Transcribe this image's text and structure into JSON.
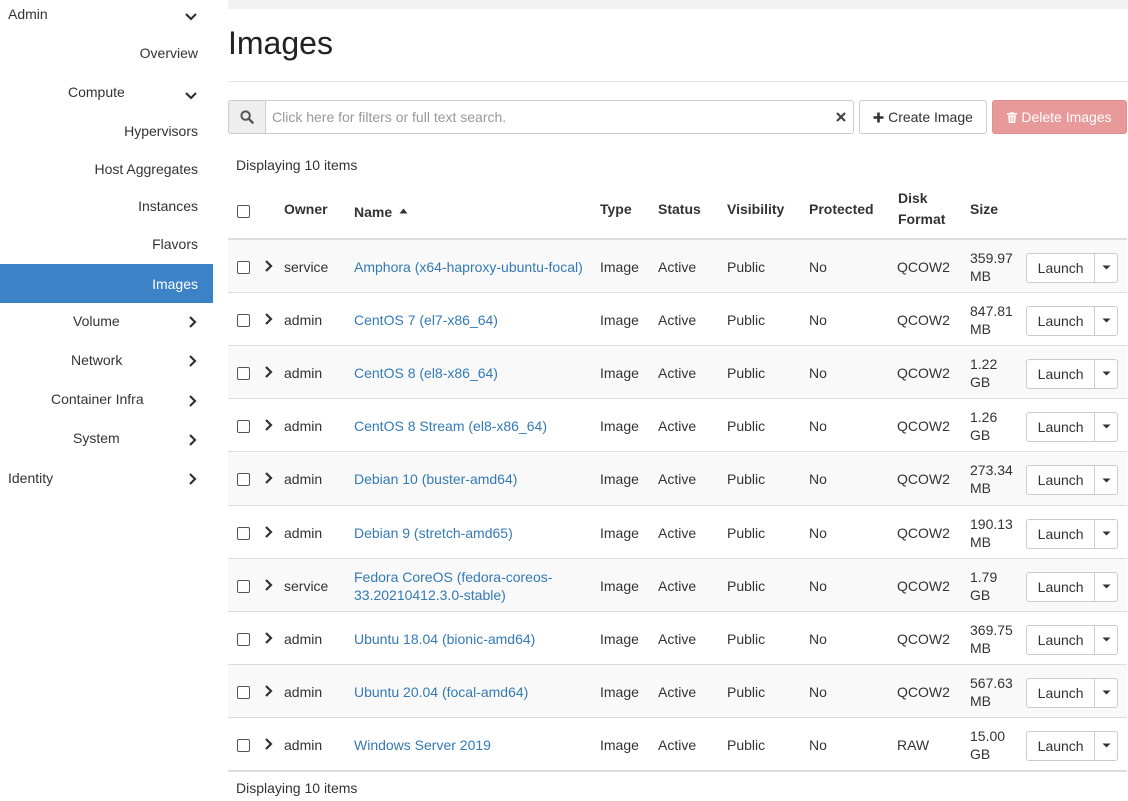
{
  "sidebar": {
    "admin": "Admin",
    "overview": "Overview",
    "compute": "Compute",
    "hypervisors": "Hypervisors",
    "host_aggregates": "Host Aggregates",
    "instances": "Instances",
    "flavors": "Flavors",
    "images": "Images",
    "volume": "Volume",
    "network": "Network",
    "container_infra": "Container Infra",
    "system": "System",
    "identity": "Identity"
  },
  "page": {
    "title": "Images"
  },
  "search": {
    "placeholder": "Click here for filters or full text search."
  },
  "toolbar": {
    "create_label": "Create Image",
    "delete_label": "Delete Images"
  },
  "table": {
    "count_top": "Displaying 10 items",
    "count_bottom": "Displaying 10 items",
    "headers": {
      "owner": "Owner",
      "name": "Name",
      "type": "Type",
      "status": "Status",
      "visibility": "Visibility",
      "protected": "Protected",
      "disk_format_1": "Disk",
      "disk_format_2": "Format",
      "size": "Size"
    },
    "launch_label": "Launch",
    "rows": [
      {
        "owner": "service",
        "name": [
          "Amphora (x64-haproxy-ubuntu-focal)"
        ],
        "type": "Image",
        "status": "Active",
        "visibility": "Public",
        "protected": "No",
        "format": "QCOW2",
        "size": [
          "359.97",
          "MB"
        ]
      },
      {
        "owner": "admin",
        "name": [
          "CentOS 7 (el7-x86_64)"
        ],
        "type": "Image",
        "status": "Active",
        "visibility": "Public",
        "protected": "No",
        "format": "QCOW2",
        "size": [
          "847.81",
          "MB"
        ]
      },
      {
        "owner": "admin",
        "name": [
          "CentOS 8 (el8-x86_64)"
        ],
        "type": "Image",
        "status": "Active",
        "visibility": "Public",
        "protected": "No",
        "format": "QCOW2",
        "size": [
          "1.22",
          "GB"
        ]
      },
      {
        "owner": "admin",
        "name": [
          "CentOS 8 Stream (el8-x86_64)"
        ],
        "type": "Image",
        "status": "Active",
        "visibility": "Public",
        "protected": "No",
        "format": "QCOW2",
        "size": [
          "1.26",
          "GB"
        ]
      },
      {
        "owner": "admin",
        "name": [
          "Debian 10 (buster-amd64)"
        ],
        "type": "Image",
        "status": "Active",
        "visibility": "Public",
        "protected": "No",
        "format": "QCOW2",
        "size": [
          "273.34",
          "MB"
        ]
      },
      {
        "owner": "admin",
        "name": [
          "Debian 9 (stretch-amd65)"
        ],
        "type": "Image",
        "status": "Active",
        "visibility": "Public",
        "protected": "No",
        "format": "QCOW2",
        "size": [
          "190.13",
          "MB"
        ]
      },
      {
        "owner": "service",
        "name": [
          "Fedora CoreOS (fedora-coreos-",
          "33.20210412.3.0-stable)"
        ],
        "type": "Image",
        "status": "Active",
        "visibility": "Public",
        "protected": "No",
        "format": "QCOW2",
        "size": [
          "1.79",
          "GB"
        ]
      },
      {
        "owner": "admin",
        "name": [
          "Ubuntu 18.04 (bionic-amd64)"
        ],
        "type": "Image",
        "status": "Active",
        "visibility": "Public",
        "protected": "No",
        "format": "QCOW2",
        "size": [
          "369.75",
          "MB"
        ]
      },
      {
        "owner": "admin",
        "name": [
          "Ubuntu 20.04 (focal-amd64)"
        ],
        "type": "Image",
        "status": "Active",
        "visibility": "Public",
        "protected": "No",
        "format": "QCOW2",
        "size": [
          "567.63",
          "MB"
        ]
      },
      {
        "owner": "admin",
        "name": [
          "Windows Server 2019"
        ],
        "type": "Image",
        "status": "Active",
        "visibility": "Public",
        "protected": "No",
        "format": "RAW",
        "size": [
          "15.00",
          "GB"
        ]
      }
    ]
  },
  "colors": {
    "active_nav": "#3c82c6",
    "link": "#337ab7",
    "danger_button": "#e89a9a"
  },
  "icons": {
    "search": "search-icon",
    "plus": "plus-icon",
    "trash": "trash-icon",
    "clear": "close-icon",
    "expand": "chevron-down-icon",
    "collapse": "chevron-right-icon",
    "sort": "sort-asc-icon",
    "caret": "caret-down-icon"
  }
}
